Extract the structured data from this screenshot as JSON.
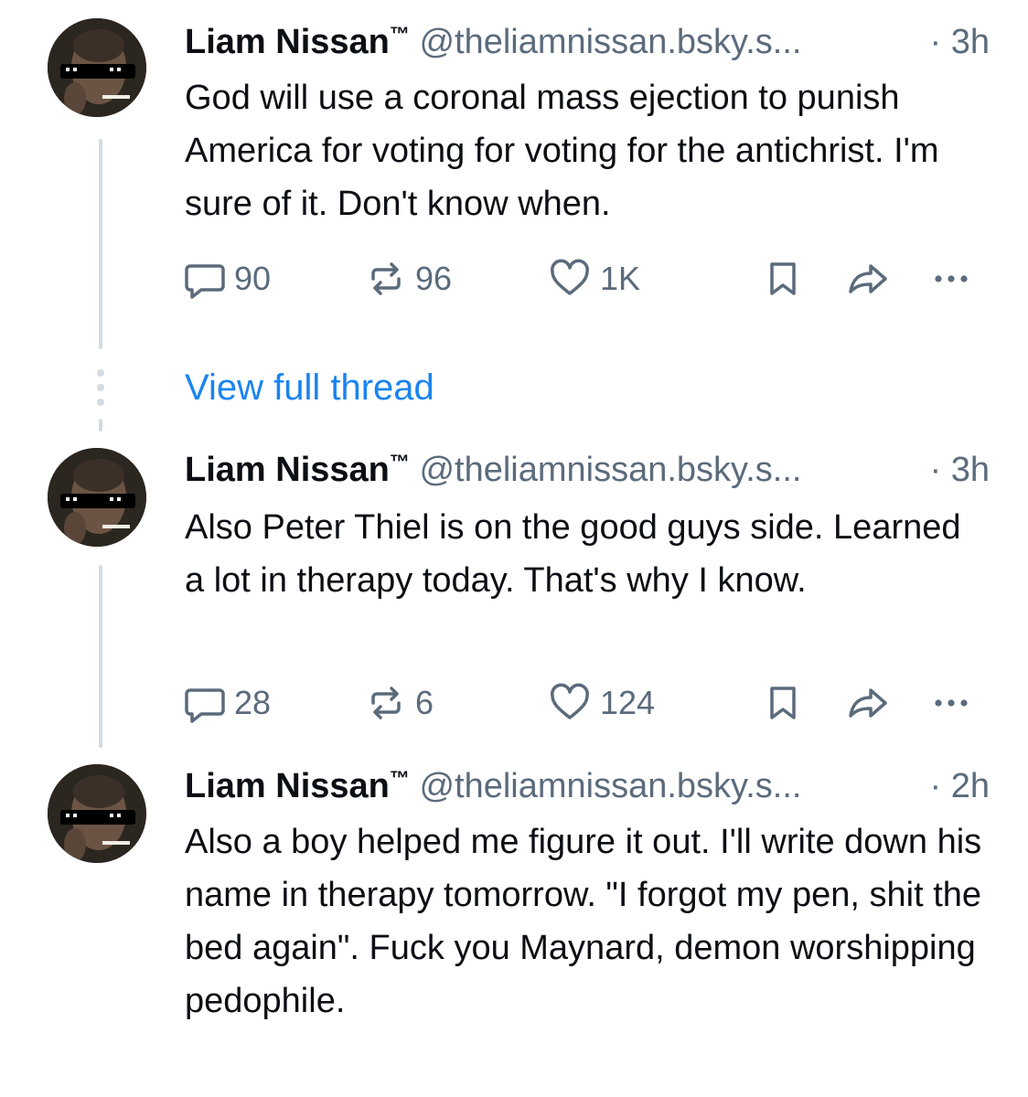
{
  "posts": [
    {
      "author": "Liam Nissan",
      "tm": "™",
      "handle": "@theliamnissan.bsky.s...",
      "separator": "·",
      "time": "3h",
      "text": "God will use a coronal mass ejection to punish America for voting for voting for the antichrist. I'm sure of it. Don't know when.",
      "replies": "90",
      "reposts": "96",
      "likes": "1K"
    },
    {
      "author": "Liam Nissan",
      "tm": "™",
      "handle": "@theliamnissan.bsky.s...",
      "separator": "·",
      "time": "3h",
      "text": "Also Peter Thiel is on the good guys side. Learned a lot in therapy today. That's why I know.",
      "replies": "28",
      "reposts": "6",
      "likes": "124"
    },
    {
      "author": "Liam Nissan",
      "tm": "™",
      "handle": "@theliamnissan.bsky.s...",
      "separator": "·",
      "time": "2h",
      "text": "Also a boy helped me figure it out. I'll write down his name in therapy tomorrow. \"I forgot my pen, shit the bed again\". Fuck you Maynard, demon worshipping pedophile."
    }
  ],
  "view_thread_label": "View full thread",
  "icons": {
    "reply": "reply-icon",
    "repost": "repost-icon",
    "like": "heart-icon",
    "bookmark": "bookmark-icon",
    "share": "share-icon",
    "more": "more-icon"
  },
  "colors": {
    "text": "#0b0f14",
    "muted": "#5b6b7c",
    "link": "#1a84f0",
    "thread_line": "#d4dbe2"
  }
}
